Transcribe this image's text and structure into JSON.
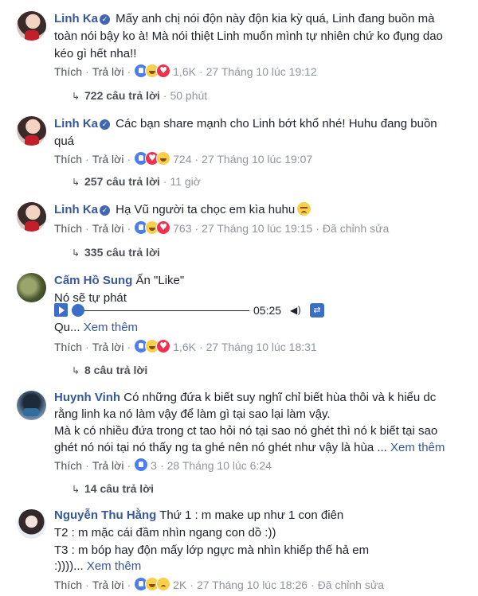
{
  "action_labels": {
    "like": "Thích",
    "reply": "Trả lời"
  },
  "comments": [
    {
      "author": "Linh Ka",
      "verified": true,
      "text": "Mấy anh chị nói độn này độn kia kỳ quá, Linh đang buồn mà toàn nói bậy ko à! Mà nói thiệt Linh muốn mình tự nhiên chứ ko đụng dao kéo gì hết nha!!",
      "reaction_icons": [
        "like-icon",
        "haha-icon",
        "love-icon"
      ],
      "reaction_count": "1,6K",
      "timestamp": "27 Tháng 10 lúc 19:12",
      "replies_label": "722 câu trả lời",
      "replies_time": "50 phút"
    },
    {
      "author": "Linh Ka",
      "verified": true,
      "text": "Các bạn share mạnh cho Linh bớt khổ nhé! Huhu đang buồn quá",
      "reaction_icons": [
        "like-icon",
        "love-icon",
        "haha-icon"
      ],
      "reaction_count": "724",
      "timestamp": "27 Tháng 10 lúc 19:07",
      "replies_label": "257 câu trả lời",
      "replies_time": "11 giờ"
    },
    {
      "author": "Linh Ka",
      "verified": true,
      "text": "Hạ Vũ người ta chọc em kìa huhu",
      "text_emoji": "sad-face-emoji",
      "reaction_icons": [
        "like-icon",
        "haha-icon",
        "love-icon"
      ],
      "reaction_count": "763",
      "timestamp": "27 Tháng 10 lúc 19:15",
      "edited": "Đã chỉnh sửa",
      "replies_label": "335 câu trả lời"
    },
    {
      "author": "Cấm Hồ Sung",
      "verified": false,
      "text": "Ấn \"Like\"",
      "line2": "Nó sẽ tự phát",
      "player_time": "05:25",
      "line4": "Qu...",
      "see_more": "Xem thêm",
      "reaction_icons": [
        "like-icon",
        "haha-icon",
        "love-icon"
      ],
      "reaction_count": "1,6K",
      "timestamp": "27 Tháng 10 lúc 18:31",
      "replies_label": "8 câu trả lời"
    },
    {
      "author": "Huynh Vinh",
      "verified": false,
      "line1": "Có những đứa k biết suy nghĩ chỉ biết hùa thôi và k hiểu dc",
      "line2": "rằng linh ka nó làm vậy để làm gì tại sao lại làm vậy.",
      "line3": "Mà k có nhiều đứa trong ct tao hỏi nó tại sao nó ghét thì nó k biết tại sao",
      "line4": "ghét nó nói tại nó thấy ng ta ghé nên nó ghét như vậy là hùa ...",
      "see_more": "Xem thêm",
      "reaction_icons": [
        "like-icon"
      ],
      "reaction_count": "3",
      "timestamp": "28 Tháng 10 lúc 6:24",
      "replies_label": "14 câu trả lời"
    },
    {
      "author": "Nguyễn Thu Hằng",
      "verified": false,
      "line1": "Thứ 1 : m make up như 1 con điên",
      "line2": "T2 : m mặc cái đầm nhìn ngang con dồ :))",
      "line3": "T3 : m bóp hay độn mấy lớp ngực mà nhìn khiếp thế hả em",
      "line4": ":))))...",
      "see_more": "Xem thêm",
      "reaction_icons": [
        "like-icon",
        "haha-icon",
        "sad-icon"
      ],
      "reaction_count": "2K",
      "timestamp": "27 Tháng 10 lúc 18:26",
      "edited": "Đã chỉnh sửa"
    }
  ]
}
